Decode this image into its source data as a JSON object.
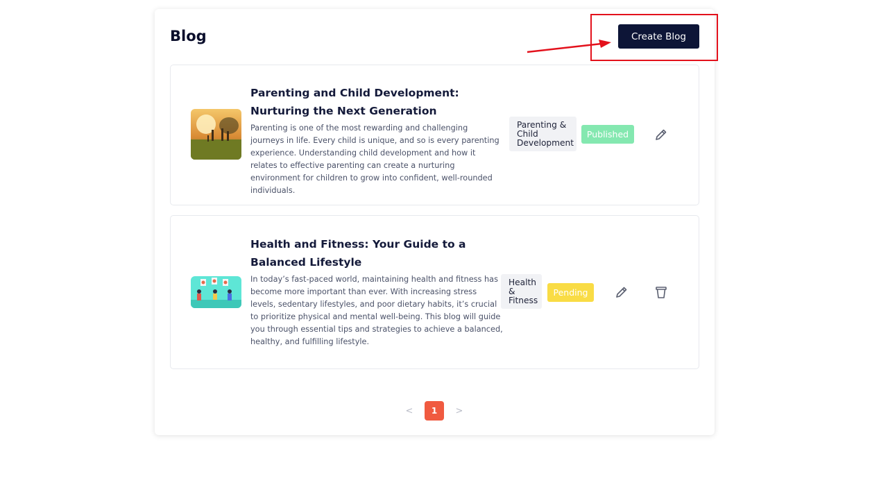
{
  "header": {
    "title": "Blog",
    "create_label": "Create Blog"
  },
  "colors": {
    "primary": "#0d1537",
    "published": "#84e8b0",
    "pending": "#f9dc45",
    "pagination_active": "#f05a40",
    "annotation": "#e3111c"
  },
  "posts": [
    {
      "title": "Parenting and Child Development: Nurturing the Next Generation",
      "body": "Parenting is one of the most rewarding and challenging journeys in life. Every child is unique, and so is every parenting experience. Understanding child development and how it relates to effective parenting can create a nurturing environment for children to grow into confident, well-rounded individuals.",
      "category": "Parenting & Child Development",
      "status": "Published",
      "actions": [
        "pencil-icon"
      ]
    },
    {
      "title": "Health and Fitness: Your Guide to a Balanced Lifestyle",
      "body": "In today’s fast-paced world, maintaining health and fitness has become more important than ever. With increasing stress levels, sedentary lifestyles, and poor dietary habits, it’s crucial to prioritize physical and mental well-being. This blog will guide you through essential tips and strategies to achieve a balanced, healthy, and fulfilling lifestyle.",
      "category": "Health & Fitness",
      "status": "Pending",
      "actions": [
        "pencil-icon",
        "trash-icon"
      ]
    }
  ],
  "pagination": {
    "prev_icon": "<",
    "current_page": "1",
    "next_icon": ">"
  }
}
